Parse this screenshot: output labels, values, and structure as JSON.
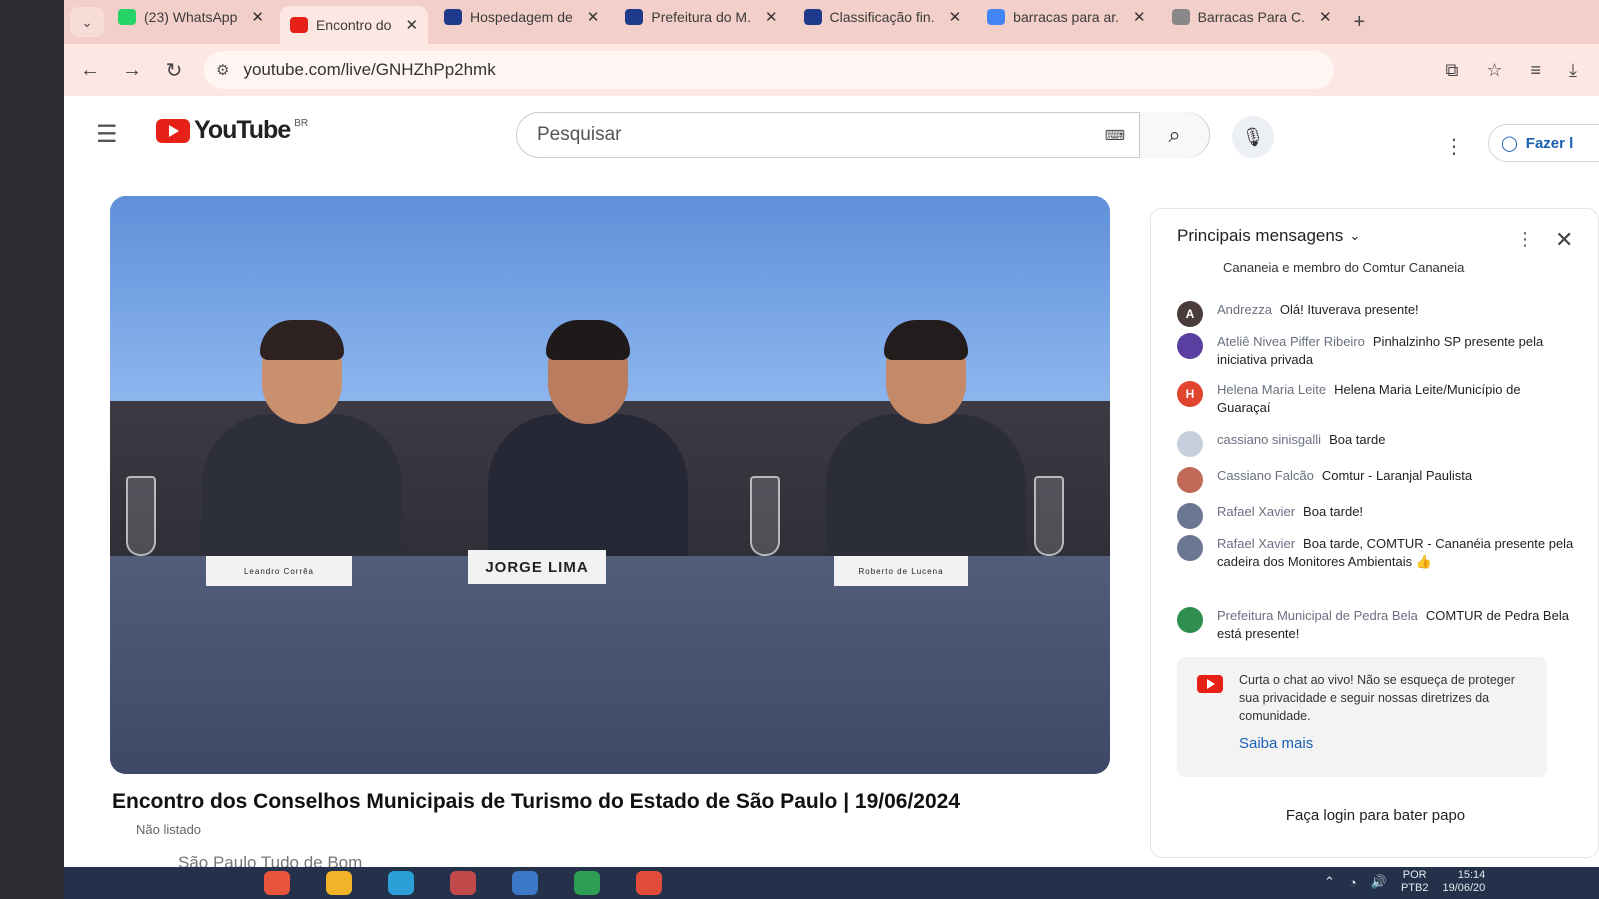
{
  "browser": {
    "tabs": [
      {
        "title": "(23) WhatsApp",
        "color": "#25d366",
        "active": false
      },
      {
        "title": "Encontro do",
        "color": "#e62117",
        "active": true
      },
      {
        "title": "Hospedagem de",
        "color": "#1f3a8a",
        "active": false
      },
      {
        "title": "Prefeitura do M.",
        "color": "#1f3a8a",
        "active": false
      },
      {
        "title": "Classificação fin.",
        "color": "#1f3a8a",
        "active": false
      },
      {
        "title": "barracas para ar.",
        "color": "#4285f4",
        "active": false
      },
      {
        "title": "Barracas Para C.",
        "color": "#888888",
        "active": false
      }
    ],
    "url": "youtube.com/live/GNHZhPp2hmk"
  },
  "youtube": {
    "logo_text": "YouTube",
    "country": "BR",
    "search_placeholder": "Pesquisar",
    "signin_label": "Fazer l"
  },
  "video": {
    "title": "Encontro dos Conselhos Municipais de Turismo do Estado de São Paulo | 19/06/2024",
    "visibility": "Não listado",
    "channel": "São Paulo Tudo de Bom",
    "nameplates": [
      "Leandro Corrêa",
      "JORGE LIMA",
      "Roberto de Lucena"
    ]
  },
  "chat": {
    "header": "Principais mensagens",
    "truncated_text": "Cananeia e membro do Comtur Cananeia",
    "messages": [
      {
        "initial": "A",
        "avatar_color": "#4a3c3a",
        "author": "Andrezza",
        "text": "Olá! Ituverava presente!"
      },
      {
        "initial": "",
        "avatar_color": "#5b3fa0",
        "author": "Ateliê Nivea Piffer Ribeiro",
        "text": "Pinhalzinho SP presente pela iniciativa privada"
      },
      {
        "initial": "H",
        "avatar_color": "#e0462d",
        "author": "Helena Maria Leite",
        "text": "Helena Maria Leite/Município de Guaraçaí"
      },
      {
        "initial": "",
        "avatar_color": "#c8cfdc",
        "author": "cassiano sinisgalli",
        "text": "Boa tarde"
      },
      {
        "initial": "",
        "avatar_color": "#c06a5a",
        "author": "Cassiano Falcão",
        "text": "Comtur - Laranjal Paulista"
      },
      {
        "initial": "",
        "avatar_color": "#6b7692",
        "author": "Rafael Xavier",
        "text": "Boa tarde!"
      },
      {
        "initial": "",
        "avatar_color": "#6b7692",
        "author": "Rafael Xavier",
        "text": "Boa tarde, COMTUR - Cananéia presente pela cadeira dos Monitores Ambientais 👍"
      },
      {
        "initial": "",
        "avatar_color": "#2f8f4e",
        "author": "Prefeitura Municipal de Pedra Bela",
        "text": "COMTUR de Pedra Bela está presente!"
      }
    ],
    "notice_text": "Curta o chat ao vivo! Não se esqueça de proteger sua privacidade e seguir nossas diretrizes da comunidade.",
    "learn_more": "Saiba mais",
    "login_prompt": "Faça login para bater papo"
  },
  "taskbar": {
    "lang": "POR",
    "layout": "PTB2",
    "time": "15:14",
    "date": "19/06/20"
  }
}
